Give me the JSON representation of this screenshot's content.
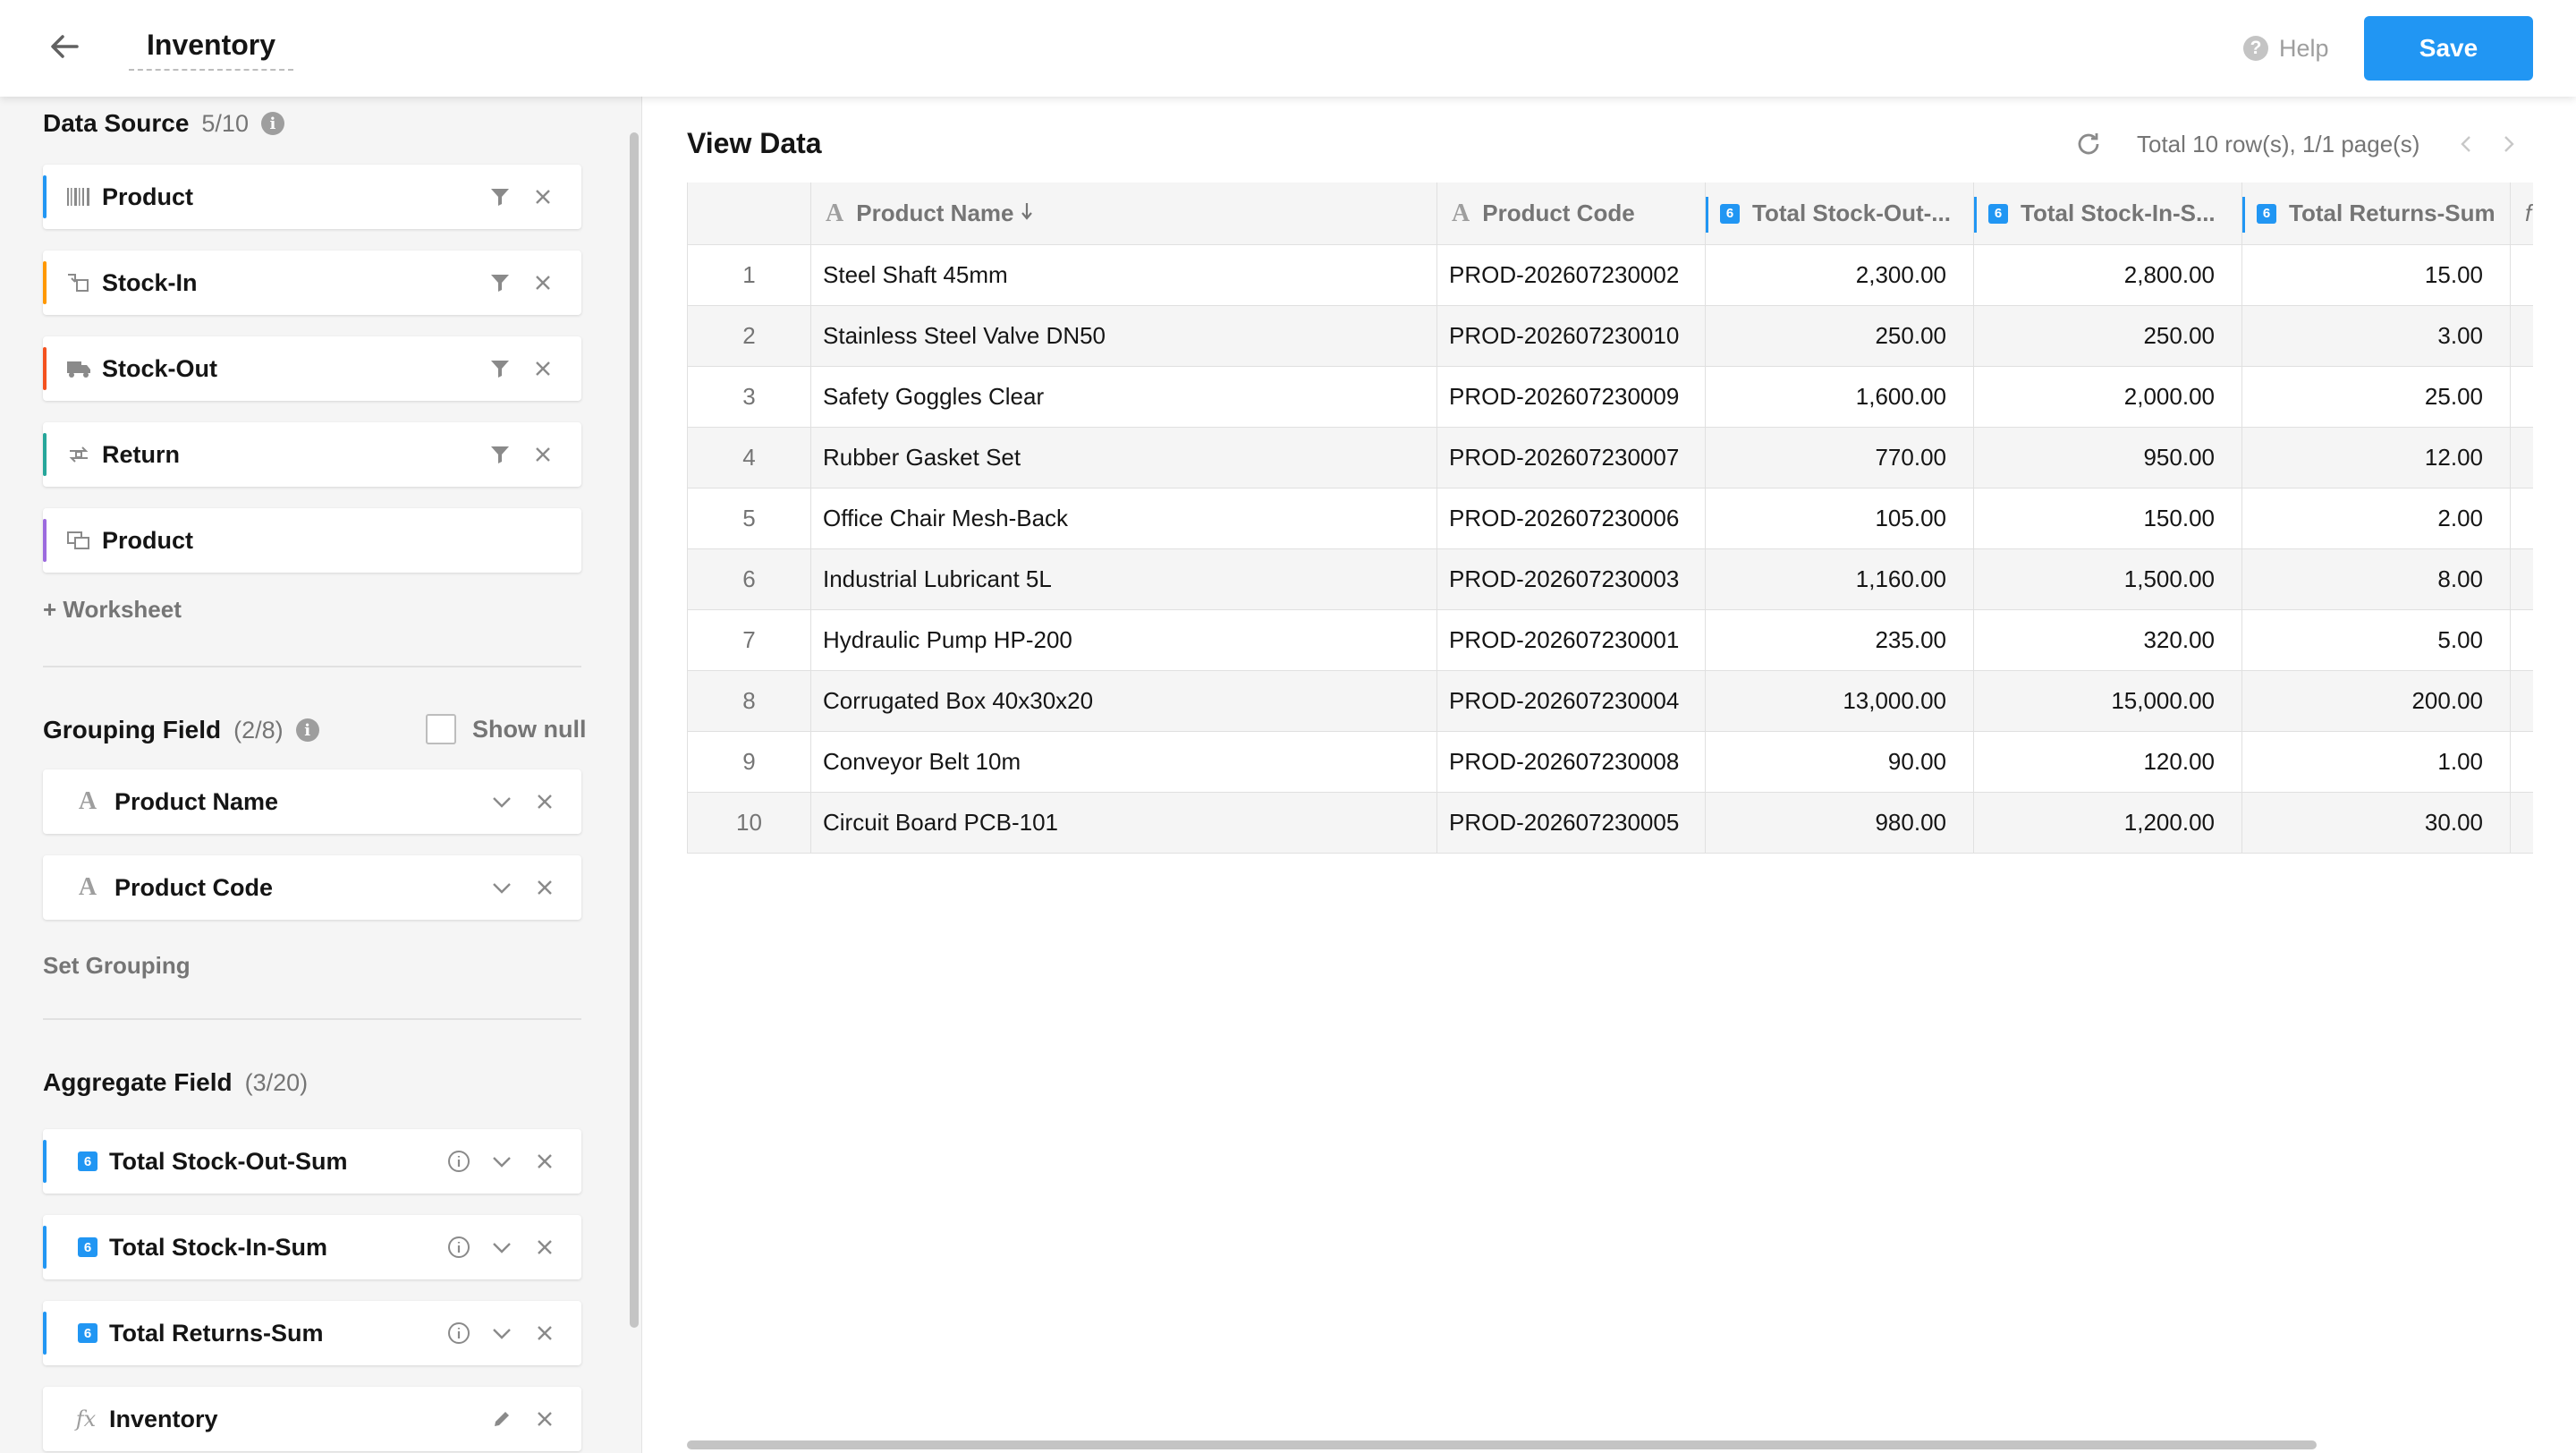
{
  "header": {
    "title": "Inventory",
    "help_label": "Help",
    "save_label": "Save"
  },
  "data_source": {
    "title": "Data Source",
    "count": "5/10",
    "items": [
      {
        "label": "Product",
        "icon": "barcode-icon",
        "color": "#2196f3",
        "filter": true
      },
      {
        "label": "Stock-In",
        "icon": "stock-in-icon",
        "color": "#ff9800",
        "filter": true
      },
      {
        "label": "Stock-Out",
        "icon": "truck-icon",
        "color": "#f4511e",
        "filter": true
      },
      {
        "label": "Return",
        "icon": "return-icon",
        "color": "#26a69a",
        "filter": true
      },
      {
        "label": "Product",
        "icon": "copy-icon",
        "color": "#9c6ade",
        "filter": false
      }
    ],
    "add_label": "+ Worksheet"
  },
  "grouping": {
    "title": "Grouping Field",
    "count": "(2/8)",
    "show_null_label": "Show null",
    "items": [
      {
        "label": "Product Name"
      },
      {
        "label": "Product Code"
      }
    ],
    "set_label": "Set Grouping"
  },
  "aggregate": {
    "title": "Aggregate Field",
    "count": "(3/20)",
    "items": [
      {
        "label": "Total Stock-Out-Sum",
        "color": "#2196f3"
      },
      {
        "label": "Total Stock-In-Sum",
        "color": "#2196f3"
      },
      {
        "label": "Total Returns-Sum",
        "color": "#2196f3"
      }
    ],
    "formula": {
      "prefix": "fx",
      "label": "Inventory"
    }
  },
  "view": {
    "title": "View Data",
    "page_info": "Total 10 row(s), 1/1 page(s)",
    "columns": [
      "",
      "Product Name",
      "Product Code",
      "Total Stock-Out-...",
      "Total Stock-In-S...",
      "Total Returns-Sum",
      "f"
    ],
    "badge_text": "6",
    "rows": [
      {
        "idx": "1",
        "name": "Steel Shaft 45mm",
        "code": "PROD-202607230002",
        "out": "2,300.00",
        "in": "2,800.00",
        "ret": "15.00"
      },
      {
        "idx": "2",
        "name": "Stainless Steel Valve DN50",
        "code": "PROD-202607230010",
        "out": "250.00",
        "in": "250.00",
        "ret": "3.00"
      },
      {
        "idx": "3",
        "name": "Safety Goggles Clear",
        "code": "PROD-202607230009",
        "out": "1,600.00",
        "in": "2,000.00",
        "ret": "25.00"
      },
      {
        "idx": "4",
        "name": "Rubber Gasket Set",
        "code": "PROD-202607230007",
        "out": "770.00",
        "in": "950.00",
        "ret": "12.00"
      },
      {
        "idx": "5",
        "name": "Office Chair Mesh-Back",
        "code": "PROD-202607230006",
        "out": "105.00",
        "in": "150.00",
        "ret": "2.00"
      },
      {
        "idx": "6",
        "name": "Industrial Lubricant 5L",
        "code": "PROD-202607230003",
        "out": "1,160.00",
        "in": "1,500.00",
        "ret": "8.00"
      },
      {
        "idx": "7",
        "name": "Hydraulic Pump HP-200",
        "code": "PROD-202607230001",
        "out": "235.00",
        "in": "320.00",
        "ret": "5.00"
      },
      {
        "idx": "8",
        "name": "Corrugated Box 40x30x20",
        "code": "PROD-202607230004",
        "out": "13,000.00",
        "in": "15,000.00",
        "ret": "200.00"
      },
      {
        "idx": "9",
        "name": "Conveyor Belt 10m",
        "code": "PROD-202607230008",
        "out": "90.00",
        "in": "120.00",
        "ret": "1.00"
      },
      {
        "idx": "10",
        "name": "Circuit Board PCB-101",
        "code": "PROD-202607230005",
        "out": "980.00",
        "in": "1,200.00",
        "ret": "30.00"
      }
    ]
  },
  "colors": {
    "accent": "#2196f3",
    "panel_bg": "#f5f5f5",
    "muted_text": "#757575"
  }
}
